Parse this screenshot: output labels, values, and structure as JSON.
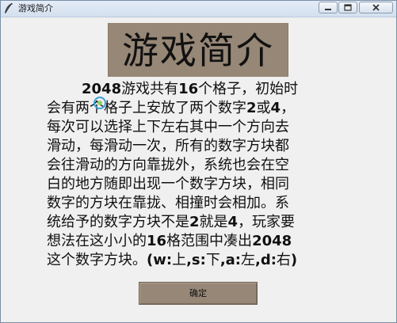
{
  "window": {
    "title": "游戏简介"
  },
  "heading": "游戏简介",
  "body_lines": [
    [
      "2048",
      "游戏共有",
      "16",
      "个格子，初始时"
    ],
    [
      "会有两个格子上安放了两个数字",
      "2",
      "或",
      "4",
      "，"
    ],
    [
      "每次可以选择上下左右其中一个方向去"
    ],
    [
      "滑动，每滑动一次，所有的数字方块都"
    ],
    [
      "会往滑动的方向靠拢外，系统也会在空"
    ],
    [
      "白的地方随即出现一个数字方块，相同"
    ],
    [
      "数字的方块在靠拢、相撞时会相加。系"
    ],
    [
      "统给予的数字方块不是",
      "2",
      "就是",
      "4",
      "，玩家要"
    ],
    [
      "想法在这小小的",
      "16",
      "格范围中凑出",
      "2048"
    ],
    [
      "这个数字方块。",
      "(w:",
      "上",
      ",s:",
      "下",
      ",a:",
      "左",
      ",d:",
      "右",
      ")"
    ]
  ],
  "ok_button": "确定",
  "colors": {
    "accent": "#978776",
    "background": "#f0f0f0"
  }
}
